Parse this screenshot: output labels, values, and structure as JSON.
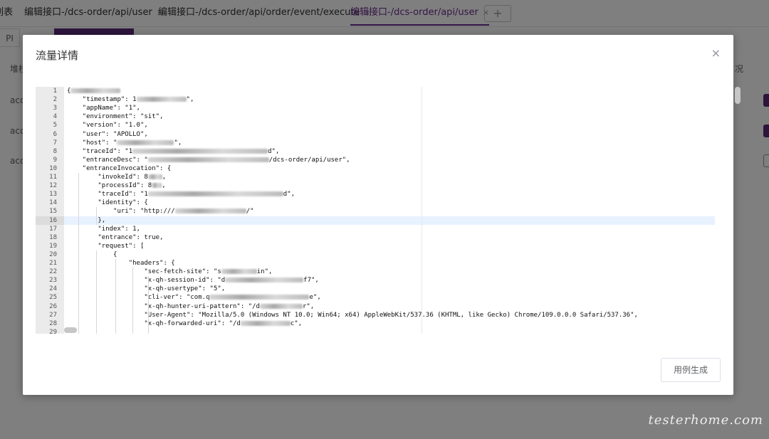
{
  "tabs": [
    {
      "label": "列表",
      "close": ""
    },
    {
      "label": "编辑接口-/dcs-order/api/user",
      "close": "×"
    },
    {
      "label": "编辑接口-/dcs-order/api/order/event/execute",
      "close": "×"
    },
    {
      "label": "编辑接口-/dcs-order/api/user",
      "close": "×"
    }
  ],
  "add_tab": "+",
  "background": {
    "sub_left": "PI",
    "row_header_left": "堆栈",
    "row_header_right": "况",
    "row_cells": [
      "acc",
      "acc",
      "acc"
    ]
  },
  "dialog": {
    "title": "流量详情",
    "close": "×",
    "generate_button": "用例生成"
  },
  "editor": {
    "active_line": 16,
    "last_line_number": "29",
    "lines": [
      {
        "n": "1",
        "pre": "{",
        "post": ""
      },
      {
        "n": "2",
        "pre": "    \"timestamp\": 1",
        "post": "\","
      },
      {
        "n": "3",
        "pre": "    \"appName\": \"1",
        "post": "\","
      },
      {
        "n": "4",
        "pre": "    \"environment\": \"sit\",",
        "post": ""
      },
      {
        "n": "5",
        "pre": "    \"version\": \"1.0\",",
        "post": ""
      },
      {
        "n": "6",
        "pre": "    \"user\": \"APOLLO\",",
        "post": ""
      },
      {
        "n": "7",
        "pre": "    \"host\": \"",
        "post": "\","
      },
      {
        "n": "8",
        "pre": "    \"traceId\": \"1",
        "post": "d\","
      },
      {
        "n": "9",
        "pre": "    \"entranceDesc\": \"",
        "post": "/dcs-order/api/user\","
      },
      {
        "n": "10",
        "pre": "    \"entranceInvocation\": {",
        "post": ""
      },
      {
        "n": "11",
        "pre": "        \"invokeId\": 8",
        "post": ","
      },
      {
        "n": "12",
        "pre": "        \"processId\": 8",
        "post": ","
      },
      {
        "n": "13",
        "pre": "        \"traceId\": \"1",
        "post": "d\","
      },
      {
        "n": "14",
        "pre": "        \"identity\": {",
        "post": ""
      },
      {
        "n": "15",
        "pre": "            \"uri\": \"http:///",
        "post": "/\""
      },
      {
        "n": "16",
        "pre": "        },",
        "post": ""
      },
      {
        "n": "17",
        "pre": "        \"index\": 1,",
        "post": ""
      },
      {
        "n": "18",
        "pre": "        \"entrance\": true,",
        "post": ""
      },
      {
        "n": "19",
        "pre": "        \"request\": [",
        "post": ""
      },
      {
        "n": "20",
        "pre": "            {",
        "post": ""
      },
      {
        "n": "21",
        "pre": "                \"headers\": {",
        "post": ""
      },
      {
        "n": "22",
        "pre": "                    \"sec-fetch-site\": \"s",
        "post": "in\","
      },
      {
        "n": "23",
        "pre": "                    \"x-qh-session-id\": \"d",
        "post": "f7\","
      },
      {
        "n": "24",
        "pre": "                    \"x-qh-usertype\": \"5\",",
        "post": ""
      },
      {
        "n": "25",
        "pre": "                    \"cli-ver\": \"com.q",
        "post": "e\","
      },
      {
        "n": "26",
        "pre": "                    \"x-qh-hunter-uri-pattern\": \"/d",
        "post": "r\","
      },
      {
        "n": "27",
        "pre": "                    \"User-Agent\": \"Mozilla/5.0 (Windows NT 10.0; Win64; x64) AppleWebKit/537.36 (KHTML, like Gecko) Chrome/109.0.0.0 Safari/537.36\",",
        "post": ""
      },
      {
        "n": "28",
        "pre": "                    \"x-qh-forwarded-uri\": \"/d",
        "post": "c\","
      }
    ]
  },
  "watermark": "testerhome.com"
}
